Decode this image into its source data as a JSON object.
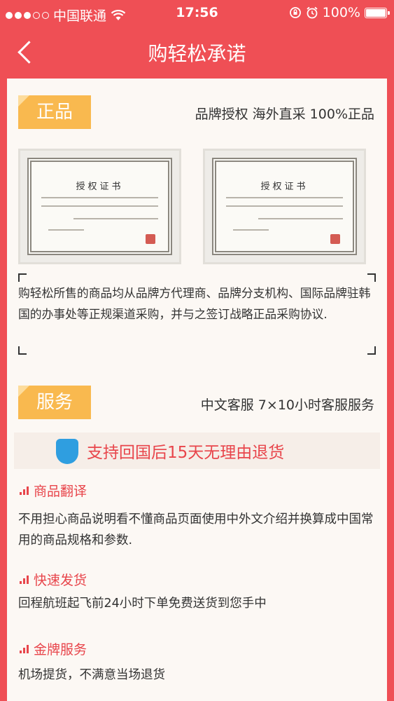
{
  "status_bar": {
    "carrier": "中国联通",
    "time": "17:56",
    "battery_percent": "100%",
    "signal_dots_filled": 3,
    "signal_dots_total": 5
  },
  "navbar": {
    "back_icon": "chevron-left-icon",
    "title": "购轻松承诺"
  },
  "authentic": {
    "tag": "正品",
    "subtitle": "品牌授权 海外直采 100%正品",
    "certificates": [
      {
        "title": "授权证书"
      },
      {
        "title": "授权证书"
      }
    ],
    "description": "购轻松所售的商品均从品牌方代理商、品牌分支机构、国际品牌驻韩国的办事处等正规渠道采购，并与之签订战略正品采购协议."
  },
  "service": {
    "tag": "服务",
    "subtitle": "中文客服 7×10小时客服服务",
    "return_banner": "支持回国后15天无理由退货",
    "features": [
      {
        "title": "商品翻译",
        "text": "不用担心商品说明看不懂商品页面使用中外文介绍并换算成中国常用的商品规格和参数."
      },
      {
        "title": "快速发货",
        "text": "回程航班起飞前24小时下单免费送货到您手中"
      },
      {
        "title": "金牌服务",
        "text": "机场提货，不满意当场退货"
      }
    ]
  },
  "colors": {
    "brand_red": "#ef4f55",
    "tag_orange": "#f9b94f",
    "text_red": "#e8454b"
  }
}
